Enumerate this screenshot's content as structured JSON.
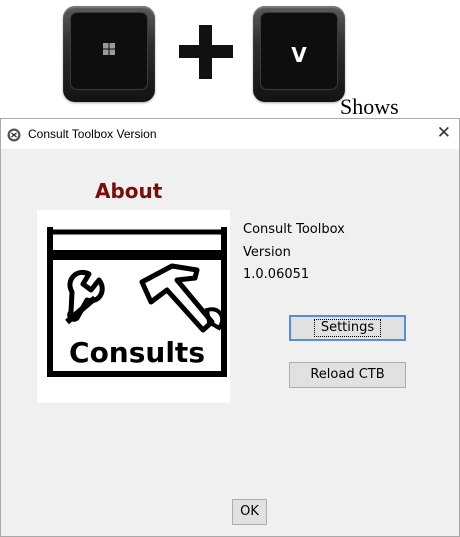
{
  "keyboard": {
    "key_left_icon": "windows-icon",
    "key_right_label": "V"
  },
  "caption": "Shows",
  "window": {
    "title": "Consult Toolbox Version",
    "close_symbol": "✕",
    "about_heading": "About",
    "logo_text": "Consults",
    "app_name": "Consult Toolbox",
    "version_label": "Version",
    "version_number": "1.0.06051",
    "settings_button": "Settings",
    "reload_button": "Reload CTB",
    "ok_button": "OK"
  },
  "colors": {
    "about_heading": "#7b0c0c",
    "button_focus_border": "#5b8bd6"
  }
}
